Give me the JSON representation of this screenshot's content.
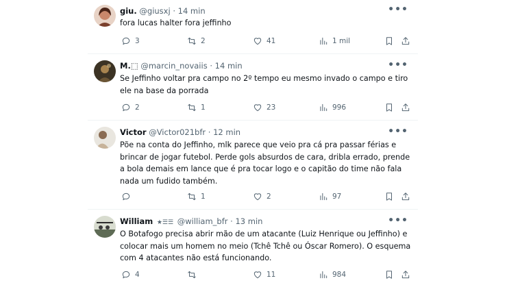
{
  "tweets": [
    {
      "name": "giu.",
      "handle": "@giusxj",
      "time": "14 min",
      "text": "fora lucas halter fora jeffinho",
      "replies": "3",
      "retweets": "2",
      "likes": "41",
      "views": "1 mil",
      "avatar_color": "#c9876b"
    },
    {
      "name": "M.⬚",
      "handle": "@marcin_novaiis",
      "time": "14 min",
      "text": "Se Jeffinho voltar pra campo no 2º tempo eu mesmo invado o campo e tiro ele na base da porrada",
      "replies": "2",
      "retweets": "1",
      "likes": "23",
      "views": "996",
      "avatar_color": "#5a4a32"
    },
    {
      "name": "Victor",
      "handle": "@Victor021bfr",
      "time": "12 min",
      "text": "Põe na conta do Jeffinho, mlk parece que veio pra cá pra passar férias e brincar de jogar futebol. Perde gols absurdos de cara, dribla errado, prende a bola demais em lance que é pra tocar logo e o capitão do time não fala nada um fudido também.",
      "replies": "",
      "retweets": "1",
      "likes": "2",
      "views": "97",
      "avatar_color": "#b9a58d"
    },
    {
      "name": "William",
      "badge": "★☰☰",
      "handle": "@william_bfr",
      "time": "13 min",
      "text": "O Botafogo precisa abrir mão de um atacante (Luiz Henrique ou Jeffinho) e colocar mais um homem no meio (Tchê Tchê ou Óscar Romero). O esquema com 4 atacantes não está funcionando.",
      "replies": "4",
      "retweets": "",
      "likes": "11",
      "views": "984",
      "avatar_color": "#6f7a6a"
    }
  ],
  "separator": "·",
  "more_label": "•••"
}
